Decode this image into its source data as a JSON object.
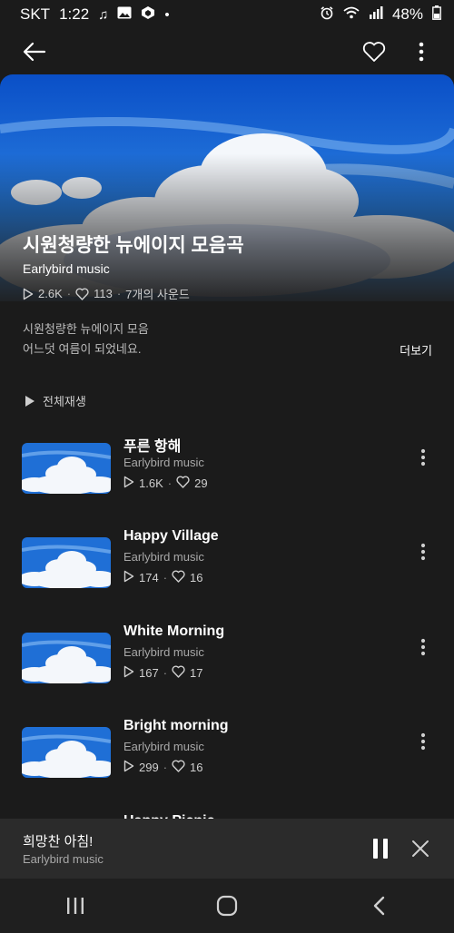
{
  "status_bar": {
    "carrier": "SKT",
    "time": "1:22",
    "battery": "48%",
    "left_icons": [
      "music-note-icon",
      "image-icon",
      "app-icon",
      "dot-icon"
    ],
    "right_icons": [
      "alarm-icon",
      "wifi-icon",
      "signal-icon",
      "battery-icon"
    ]
  },
  "header": {
    "back_icon": "arrow-left-icon",
    "like_icon": "heart-outline-icon",
    "menu_icon": "more-vert-icon"
  },
  "playlist": {
    "title": "시원청량한 뉴에이지 모음곡",
    "artist": "Earlybird music",
    "plays": "2.6K",
    "likes": "113",
    "track_count": "7개의 사운드",
    "description_line1": "시원청량한 뉴에이지 모음",
    "description_line2": "어느덧 여름이 되었네요.",
    "more_label": "더보기",
    "play_all_label": "전체재생"
  },
  "tracks": [
    {
      "title": "푸른 항해",
      "artist": "Earlybird music",
      "plays": "1.6K",
      "likes": "29"
    },
    {
      "title": "Happy Village",
      "artist": "Earlybird music",
      "plays": "174",
      "likes": "16"
    },
    {
      "title": "White Morning",
      "artist": "Earlybird music",
      "plays": "167",
      "likes": "17"
    },
    {
      "title": "Bright morning",
      "artist": "Earlybird music",
      "plays": "299",
      "likes": "16"
    },
    {
      "title": "Happy Picnic",
      "artist": "",
      "plays": "",
      "likes": ""
    }
  ],
  "mini_player": {
    "title": "희망찬 아침!",
    "artist": "Earlybird music",
    "pause_icon": "pause-icon",
    "close_icon": "close-icon"
  },
  "nav_bar": {
    "icons": [
      "recent-apps-icon",
      "home-icon",
      "back-icon"
    ]
  },
  "colors": {
    "background": "#1b1b1b",
    "mini_player_bg": "#2b2b2b",
    "sky_blue": "#1f6fd6",
    "text_secondary": "#a8a8a8"
  }
}
